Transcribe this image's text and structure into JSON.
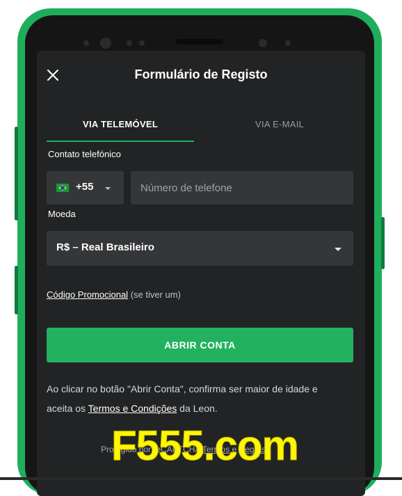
{
  "form": {
    "title": "Formulário de Registo",
    "tabs": [
      {
        "label": "VIA TELEMÓVEL",
        "active": true
      },
      {
        "label": "VIA E-MAIL",
        "active": false
      }
    ],
    "phone_label": "Contato telefónico",
    "country_code": "+55",
    "phone_placeholder": "Número de telefone",
    "phone_value": "",
    "currency_label": "Moeda",
    "currency_value": "R$ – Real Brasileiro",
    "promo_link": "Código Promocional",
    "promo_note": "(se tiver um)",
    "open_account_label": "ABRIR CONTA",
    "disclaimer_prefix": "Ao clicar no botão \"Abrir Conta\", confirma ser maior de idade e aceita os ",
    "disclaimer_link": "Termos e Condições",
    "disclaimer_suffix": " da Leon.",
    "recaptcha_prefix": "Protegido por reCAPTCHA ",
    "recaptcha_terms": "Termos",
    "recaptcha_and": " e ",
    "recaptcha_rules": "Regras"
  },
  "watermark": "F555.com",
  "colors": {
    "phone_frame": "#1fae5b",
    "screen_bg": "#222324",
    "input_bg": "#353638",
    "accent_green": "#22b25f",
    "watermark_yellow": "#fff600"
  },
  "icons": {
    "close": "close-icon",
    "flag": "brazil-flag-icon",
    "dropdown": "chevron-down-icon"
  }
}
